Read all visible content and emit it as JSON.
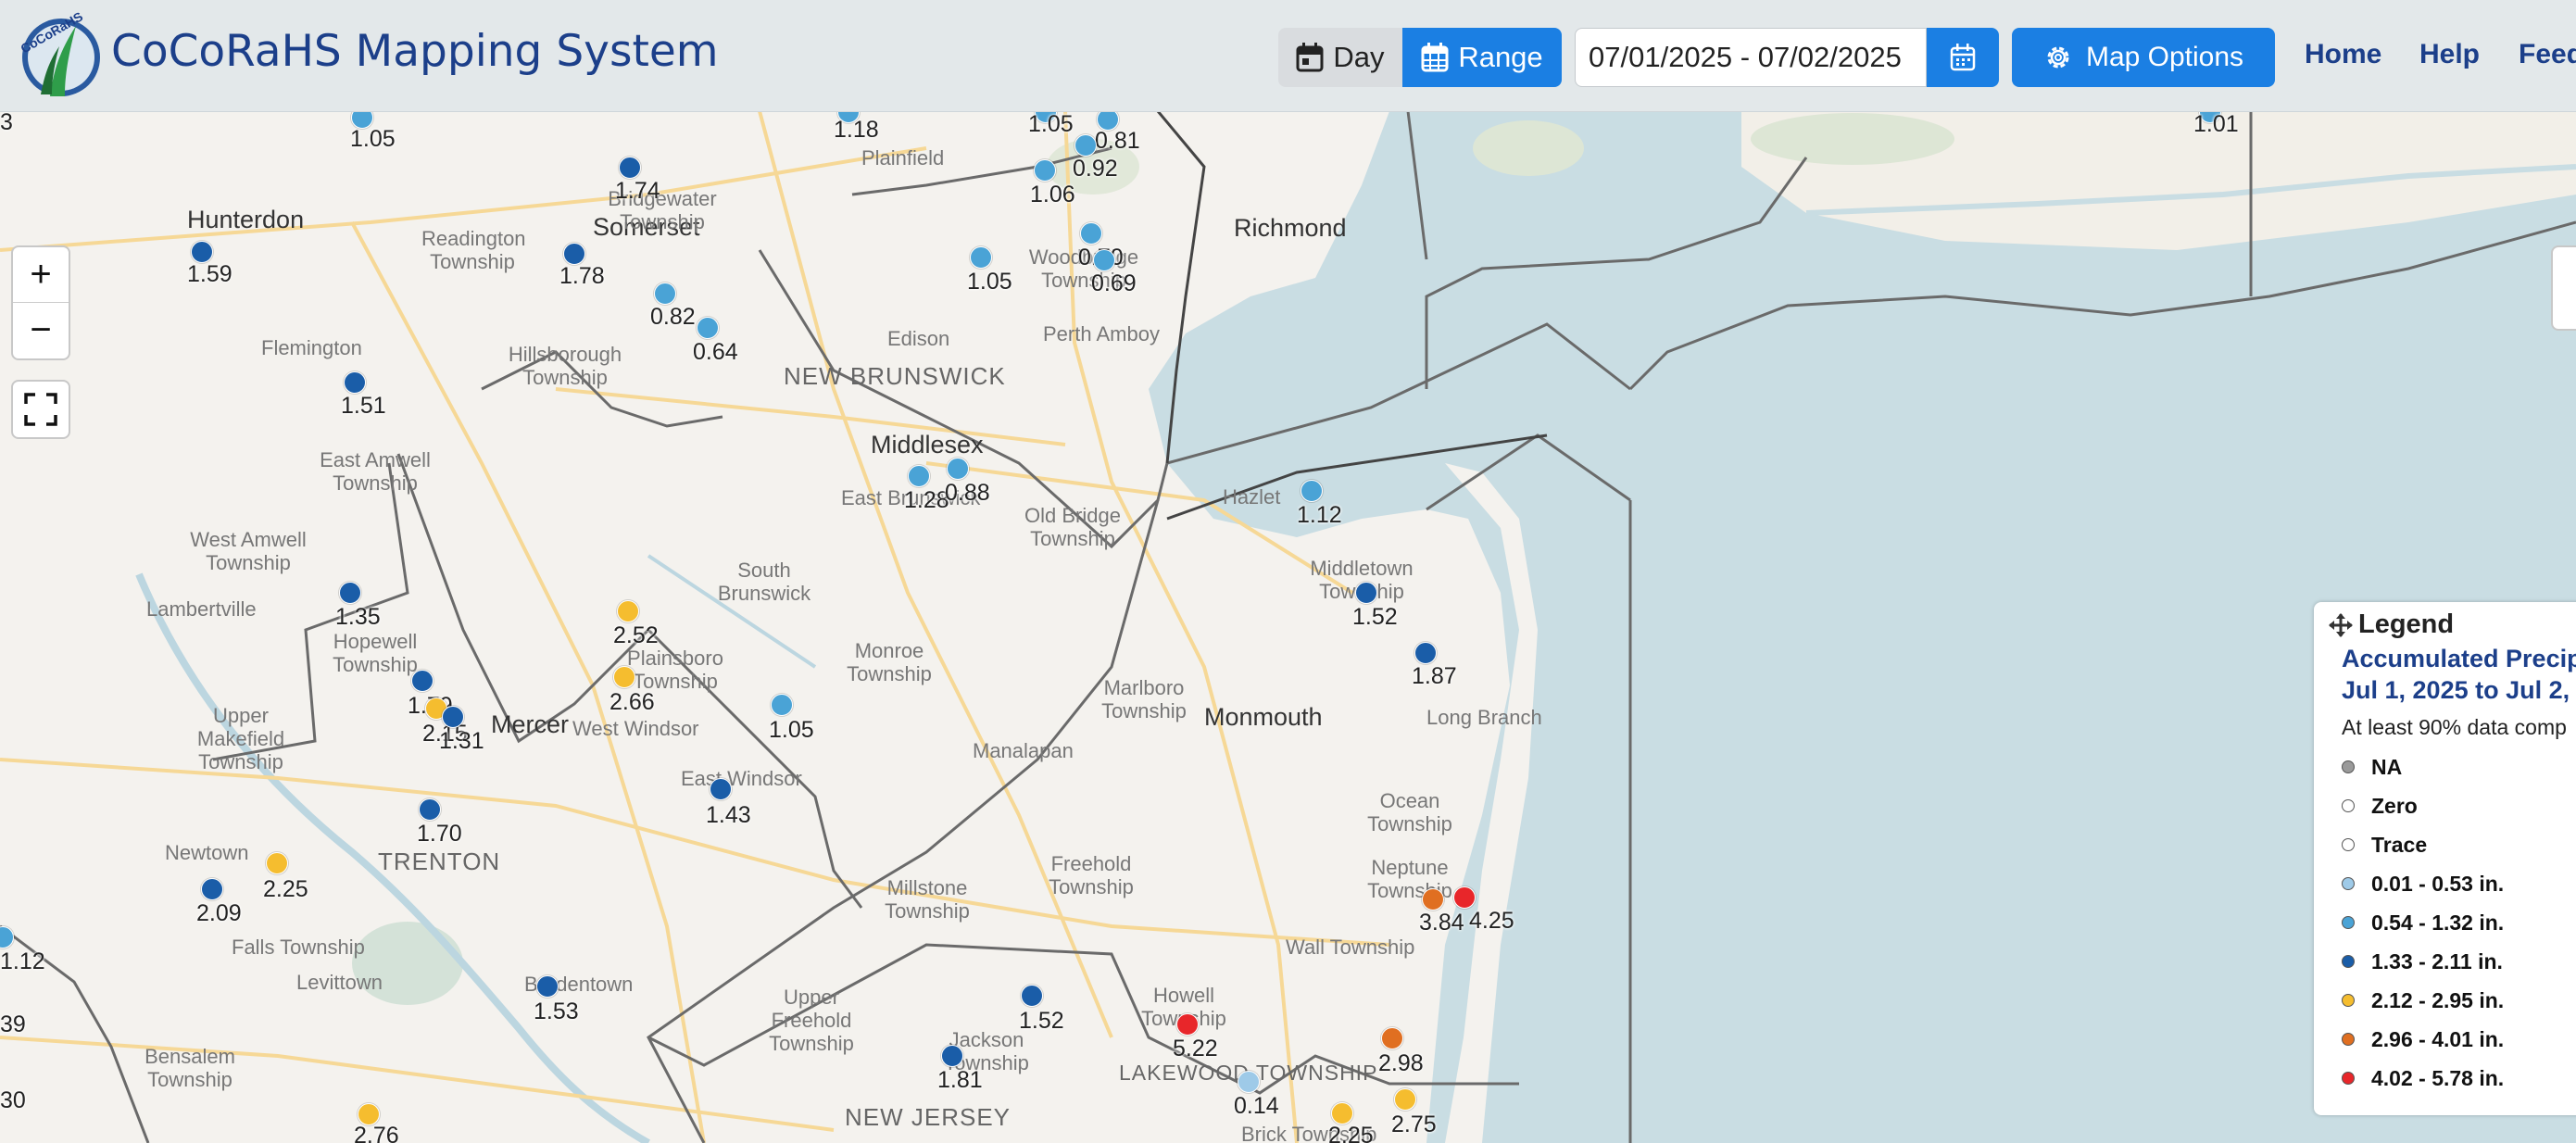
{
  "header": {
    "title": "CoCoRaHS Mapping System",
    "logo_text": "CoCoRaHS",
    "day_label": "Day",
    "range_label": "Range",
    "date_range": "07/01/2025 - 07/02/2025",
    "map_options_label": "Map Options",
    "nav": [
      "Home",
      "Help",
      "Feed"
    ],
    "colors": {
      "accent": "#1b7fe3",
      "title": "#1c3f8a"
    }
  },
  "icons": {
    "calendar": "calendar-icon",
    "grid_calendar": "calendar-range-icon",
    "gear": "gear-icon",
    "move": "move-icon",
    "fullscreen": "fullscreen-icon"
  },
  "map": {
    "zoom_in": "+",
    "zoom_out": "−",
    "place_labels": [
      {
        "text": "Hunterdon",
        "type": "county"
      },
      {
        "text": "Somerset",
        "type": "county"
      },
      {
        "text": "Middlesex",
        "type": "county"
      },
      {
        "text": "Mercer",
        "type": "county"
      },
      {
        "text": "Monmouth",
        "type": "county"
      },
      {
        "text": "Richmond",
        "type": "county"
      },
      {
        "text": "NEW BRUNSWICK",
        "type": "city"
      },
      {
        "text": "TRENTON",
        "type": "city"
      },
      {
        "text": "NEW JERSEY",
        "type": "city"
      },
      {
        "text": "LAKEWOOD TOWNSHIP",
        "type": "city"
      },
      {
        "text": "Plainfield",
        "type": "town"
      },
      {
        "text": "Bridgewater Township",
        "type": "town"
      },
      {
        "text": "Readington Township",
        "type": "town"
      },
      {
        "text": "Flemington",
        "type": "town"
      },
      {
        "text": "Hillsborough Township",
        "type": "town"
      },
      {
        "text": "East Amwell Township",
        "type": "town"
      },
      {
        "text": "West Amwell Township",
        "type": "town"
      },
      {
        "text": "Lambertville",
        "type": "town"
      },
      {
        "text": "Hopewell Township",
        "type": "town"
      },
      {
        "text": "Upper Makefield Township",
        "type": "town"
      },
      {
        "text": "Newtown",
        "type": "town"
      },
      {
        "text": "Falls Township",
        "type": "town"
      },
      {
        "text": "Levittown",
        "type": "town"
      },
      {
        "text": "Bensalem Township",
        "type": "town"
      },
      {
        "text": "Bordentown",
        "type": "town"
      },
      {
        "text": "Edison",
        "type": "town"
      },
      {
        "text": "Woodbridge Township",
        "type": "town"
      },
      {
        "text": "Perth Amboy",
        "type": "town"
      },
      {
        "text": "East Brunswick",
        "type": "town"
      },
      {
        "text": "Old Bridge Township",
        "type": "town"
      },
      {
        "text": "South Brunswick",
        "type": "town"
      },
      {
        "text": "Plainsboro Township",
        "type": "town"
      },
      {
        "text": "West Windsor",
        "type": "town"
      },
      {
        "text": "East Windsor",
        "type": "town"
      },
      {
        "text": "Monroe Township",
        "type": "town"
      },
      {
        "text": "Manalapan",
        "type": "town"
      },
      {
        "text": "Marlboro Township",
        "type": "town"
      },
      {
        "text": "Hazlet",
        "type": "town"
      },
      {
        "text": "Middletown Township",
        "type": "town"
      },
      {
        "text": "Long Branch",
        "type": "town"
      },
      {
        "text": "Ocean Township",
        "type": "town"
      },
      {
        "text": "Neptune Township",
        "type": "town"
      },
      {
        "text": "Wall Township",
        "type": "town"
      },
      {
        "text": "Freehold Township",
        "type": "town"
      },
      {
        "text": "Millstone Township",
        "type": "town"
      },
      {
        "text": "Upper Freehold Township",
        "type": "town"
      },
      {
        "text": "Jackson Township",
        "type": "town"
      },
      {
        "text": "Howell Township",
        "type": "town"
      },
      {
        "text": "Brick Township",
        "type": "town"
      }
    ],
    "stations": [
      {
        "value": "1.05",
        "cat": "c054"
      },
      {
        "value": "1.18",
        "cat": "c054"
      },
      {
        "value": "1.05",
        "cat": "c054"
      },
      {
        "value": "0.81",
        "cat": "c054"
      },
      {
        "value": "0.92",
        "cat": "c054"
      },
      {
        "value": "1.06",
        "cat": "c054"
      },
      {
        "value": "1.01",
        "cat": "c054"
      },
      {
        "value": "1.74",
        "cat": "c133"
      },
      {
        "value": "1.59",
        "cat": "c133"
      },
      {
        "value": "1.78",
        "cat": "c133"
      },
      {
        "value": "0.82",
        "cat": "c054"
      },
      {
        "value": "0.64",
        "cat": "c054"
      },
      {
        "value": "1.05",
        "cat": "c054"
      },
      {
        "value": "0.70",
        "cat": "c054"
      },
      {
        "value": "0.69",
        "cat": "c054"
      },
      {
        "value": "1.51",
        "cat": "c133"
      },
      {
        "value": "1.28",
        "cat": "c054"
      },
      {
        "value": "0.88",
        "cat": "c054"
      },
      {
        "value": "1.12",
        "cat": "c054"
      },
      {
        "value": "1.35",
        "cat": "c133"
      },
      {
        "value": "2.52",
        "cat": "c212"
      },
      {
        "value": "1.52",
        "cat": "c133"
      },
      {
        "value": "1.87",
        "cat": "c133"
      },
      {
        "value": "2.66",
        "cat": "c212"
      },
      {
        "value": "1.79",
        "cat": "c133"
      },
      {
        "value": "2.15",
        "cat": "c212"
      },
      {
        "value": "1.31",
        "cat": "c133"
      },
      {
        "value": "1.05",
        "cat": "c054"
      },
      {
        "value": "1.43",
        "cat": "c133"
      },
      {
        "value": "1.70",
        "cat": "c133"
      },
      {
        "value": "2.25",
        "cat": "c212"
      },
      {
        "value": "2.09",
        "cat": "c133"
      },
      {
        "value": "3.84",
        "cat": "c296"
      },
      {
        "value": "4.25",
        "cat": "c402"
      },
      {
        "value": "1.12",
        "cat": "c054"
      },
      {
        "value": "1.53",
        "cat": "c133"
      },
      {
        "value": "1.52",
        "cat": "c133"
      },
      {
        "value": "5.22",
        "cat": "c402"
      },
      {
        "value": "1.81",
        "cat": "c133"
      },
      {
        "value": "2.98",
        "cat": "c296"
      },
      {
        "value": "0.14",
        "cat": "c001"
      },
      {
        "value": "2.25",
        "cat": "c212"
      },
      {
        "value": "2.75",
        "cat": "c212"
      },
      {
        "value": "2.76",
        "cat": "c212"
      },
      {
        "value": "39",
        "cat": "none"
      },
      {
        "value": "30",
        "cat": "none"
      },
      {
        "value": "3",
        "cat": "none"
      }
    ]
  },
  "legend": {
    "title": "Legend",
    "subtitle1": "Accumulated Precip",
    "subtitle2": "Jul 1, 2025 to Jul 2,",
    "subtitle3": "At least 90% data comp",
    "items": [
      {
        "label": "NA",
        "color": "#9a9a9a"
      },
      {
        "label": "Zero",
        "color": "#ffffff"
      },
      {
        "label": "Trace",
        "color": "#ffffff"
      },
      {
        "label": "0.01 - 0.53 in.",
        "color": "#9ecae8"
      },
      {
        "label": "0.54 - 1.32 in.",
        "color": "#4aa3d6"
      },
      {
        "label": "1.33 - 2.11 in.",
        "color": "#1a5da8"
      },
      {
        "label": "2.12 - 2.95 in.",
        "color": "#f5bd2f"
      },
      {
        "label": "2.96 - 4.01 in.",
        "color": "#e06f21"
      },
      {
        "label": "4.02 - 5.78 in.",
        "color": "#e8262a"
      }
    ]
  },
  "category_colors": {
    "c001": "#9ecae8",
    "c054": "#4aa3d6",
    "c133": "#1a5da8",
    "c212": "#f5bd2f",
    "c296": "#e06f21",
    "c402": "#e8262a",
    "none": "transparent"
  }
}
